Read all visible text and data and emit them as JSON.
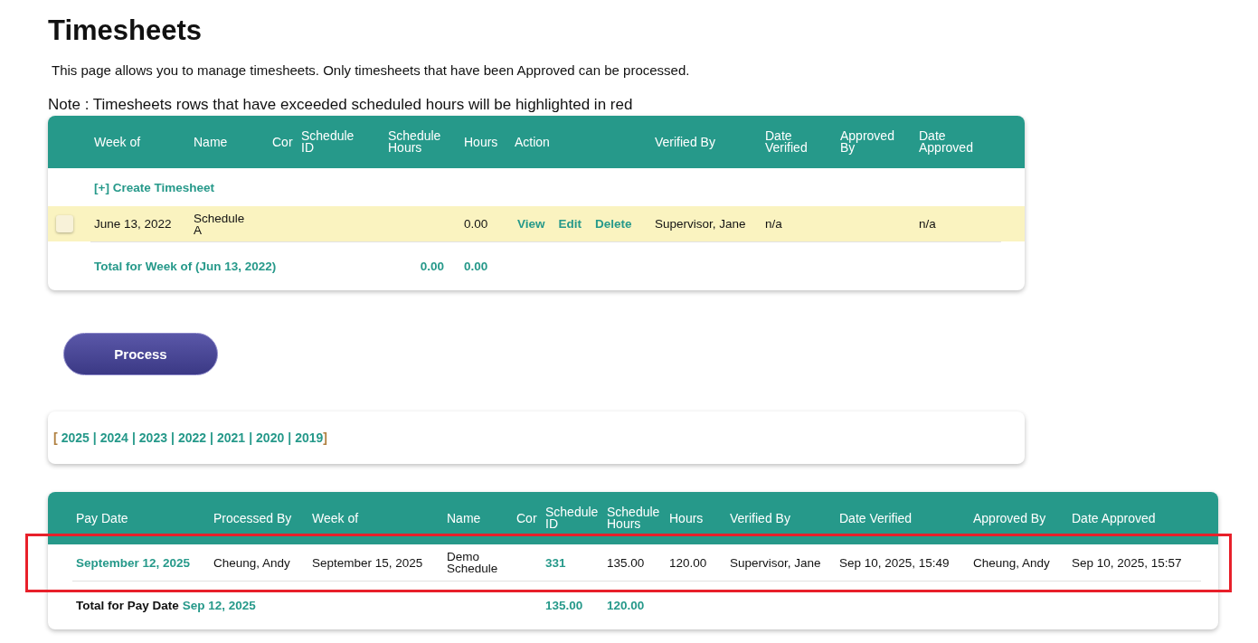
{
  "page": {
    "title": "Timesheets",
    "intro": "This page allows you to manage timesheets. Only timesheets that have been Approved can be processed.",
    "note": "Note : Timesheets rows that have exceeded scheduled hours will be highlighted in red"
  },
  "timesheets": {
    "columns": [
      "Week of",
      "Name",
      "Cor",
      "Schedule ID",
      "Schedule Hours",
      "Hours",
      "Action",
      "Verified By",
      "Date Verified",
      "Approved By",
      "Date Approved"
    ],
    "create_link": "[+] Create Timesheet",
    "rows": [
      {
        "checked": false,
        "highlighted": true,
        "week_of": "June 13, 2022",
        "name": "Schedule A",
        "hours": "0.00",
        "actions": [
          "View",
          "Edit",
          "Delete"
        ],
        "verified_by": "Supervisor, Jane",
        "date_verified": "n/a",
        "date_approved": "n/a"
      }
    ],
    "total": {
      "label": "Total for Week of (Jun 13, 2022)",
      "schedule_hours": "0.00",
      "hours": "0.00"
    }
  },
  "process_button": "Process",
  "years": {
    "open": "[",
    "close": "]",
    "separator": "|",
    "items": [
      "2025",
      "2024",
      "2023",
      "2022",
      "2021",
      "2020",
      "2019"
    ]
  },
  "processed": {
    "columns": [
      "Pay Date",
      "Processed By",
      "Week of",
      "Name",
      "Cor",
      "Schedule ID",
      "Schedule Hours",
      "Hours",
      "Verified By",
      "Date Verified",
      "Approved By",
      "Date Approved"
    ],
    "rows": [
      {
        "pay_date": "September 12, 2025",
        "processed_by": "Cheung, Andy",
        "week_of": "September 15, 2025",
        "name": "Demo Schedule",
        "schedule_id": "331",
        "schedule_hours": "135.00",
        "hours": "120.00",
        "verified_by": "Supervisor, Jane",
        "date_verified": "Sep 10, 2025, 15:49",
        "approved_by": "Cheung, Andy",
        "date_approved": "Sep 10, 2025, 15:57"
      }
    ],
    "total": {
      "label": "Total for Pay Date",
      "date": "Sep 12, 2025",
      "schedule_hours": "135.00",
      "hours": "120.00"
    }
  }
}
